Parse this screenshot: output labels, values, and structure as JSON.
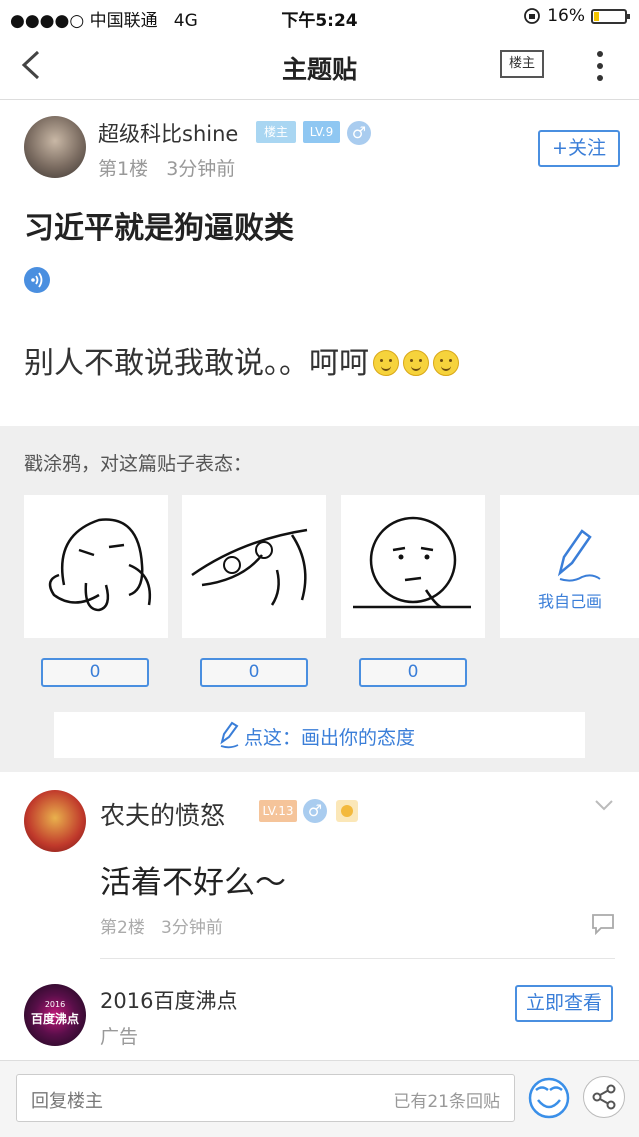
{
  "status_bar": {
    "carrier": "●●●●○ 中国联通",
    "network": "4G",
    "time": "下午5:24",
    "battery": "16%",
    "battery_level": 0.16
  },
  "nav": {
    "title": "主题贴",
    "louzhu_label": "楼主"
  },
  "post": {
    "username": "超级科比shine",
    "badges": {
      "role": "楼主",
      "level": "LV.9"
    },
    "floor": "第1楼",
    "time": "3分钟前",
    "follow_label": "+关注",
    "title": "习近平就是狗逼败类",
    "body": "别人不敢说我敢说。。呵呵"
  },
  "doodle": {
    "heading": "戳涂鸦，对这篇贴子表态：",
    "counts": [
      "0",
      "0",
      "0"
    ],
    "my_draw_label": "我自己画",
    "draw_bar_label": "点这：画出你的态度"
  },
  "reply": {
    "username": "农夫的愤怒",
    "level": "LV.13",
    "body": "活着不好么～",
    "floor": "第2楼",
    "time": "3分钟前"
  },
  "ad": {
    "avatar_line1": "2016",
    "avatar_line2": "百度沸点",
    "title": "2016百度沸点",
    "subtitle": "广告",
    "cta": "立即查看"
  },
  "bottom_bar": {
    "placeholder": "回复楼主",
    "reply_count": "已有21条回贴"
  },
  "colors": {
    "accent": "#4a8fe0",
    "badge_role": "#9fd0f0",
    "badge_level": "#8fc7f2",
    "badge_level_reply": "#f5b88a"
  }
}
